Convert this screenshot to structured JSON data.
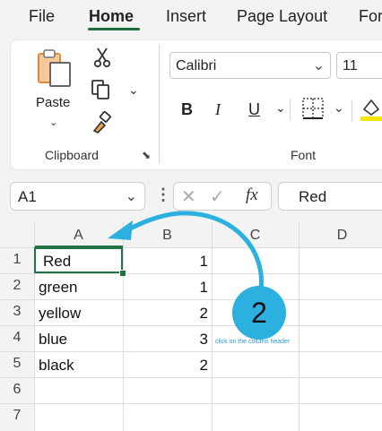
{
  "menu": {
    "tabs": [
      {
        "label": "File"
      },
      {
        "label": "Home"
      },
      {
        "label": "Insert"
      },
      {
        "label": "Page Layout"
      },
      {
        "label": "For"
      }
    ],
    "active_tab": "Home"
  },
  "ribbon": {
    "clipboard": {
      "paste_label": "Paste",
      "group_label": "Clipboard"
    },
    "font": {
      "font_name": "Calibri",
      "font_size": "11",
      "group_label": "Font",
      "bold": "B",
      "italic": "I",
      "underline": "U"
    }
  },
  "formula_bar": {
    "name_box": "A1",
    "fx": "fx",
    "value": "Red"
  },
  "sheet": {
    "columns": [
      "A",
      "B",
      "C",
      "D"
    ],
    "rows": [
      "1",
      "2",
      "3",
      "4",
      "5",
      "6",
      "7"
    ],
    "cells": [
      {
        "a": "Red",
        "b": "1"
      },
      {
        "a": "green",
        "b": "1"
      },
      {
        "a": "yellow",
        "b": "2"
      },
      {
        "a": "blue",
        "b": "3"
      },
      {
        "a": "black",
        "b": "2"
      }
    ]
  },
  "annotation": {
    "step": "2",
    "caption": "click on the column header",
    "color": "#2bb0e0"
  },
  "colors": {
    "accent_green": "#1e6c3f",
    "selection_green": "#217346"
  }
}
